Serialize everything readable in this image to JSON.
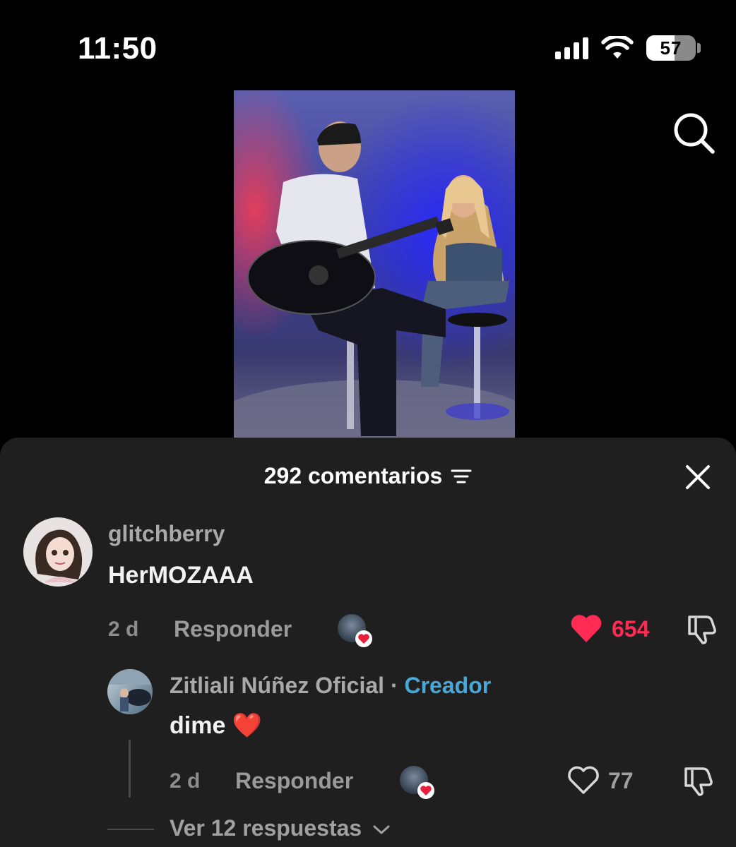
{
  "status_bar": {
    "time": "11:50",
    "battery": "57",
    "battery_level": 0.57
  },
  "icons": [
    "signal-icon",
    "wifi-icon",
    "battery-icon",
    "search-icon",
    "sort-icon",
    "close-icon",
    "heart-icon",
    "dislike-icon",
    "chevron-down-icon"
  ],
  "comments_header": {
    "title": "292 comentarios"
  },
  "comment": {
    "username": "glitchberry",
    "text": "HerMOZAAA",
    "age": "2 d",
    "reply_label": "Responder",
    "likes": "654",
    "liked": true
  },
  "reply": {
    "username": "Zitliali Núñez Oficial",
    "separator": "·",
    "badge": "Creador",
    "text": "dime ❤️",
    "age": "2 d",
    "reply_label": "Responder",
    "likes": "77",
    "liked": false
  },
  "view_replies": "Ver 12 respuestas",
  "colors": {
    "like_red": "#fe2c55",
    "creator_blue": "#4aa8d8",
    "sheet_bg": "#1f1f1f"
  }
}
